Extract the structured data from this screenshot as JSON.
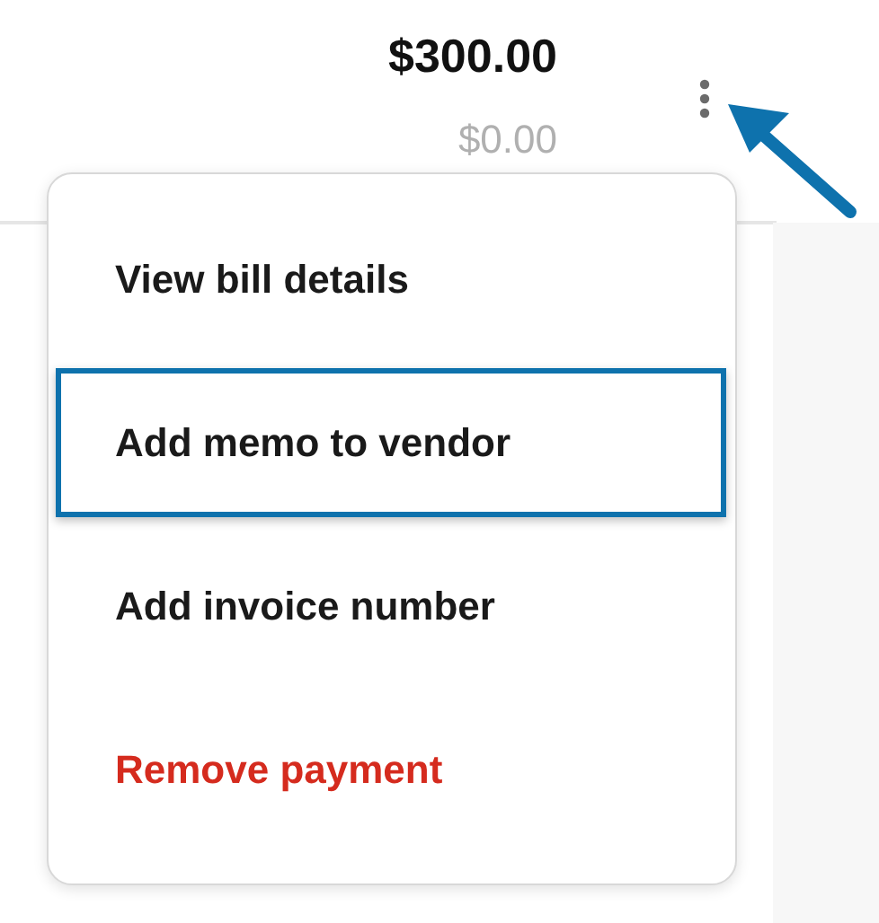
{
  "amount": {
    "total": "$300.00",
    "paid": "$0.00"
  },
  "menu": {
    "items": [
      {
        "label": "View bill details",
        "kind": "normal",
        "selected": false
      },
      {
        "label": "Add memo to vendor",
        "kind": "normal",
        "selected": true
      },
      {
        "label": "Add invoice number",
        "kind": "normal",
        "selected": false
      },
      {
        "label": "Remove payment",
        "kind": "danger",
        "selected": false
      }
    ]
  }
}
